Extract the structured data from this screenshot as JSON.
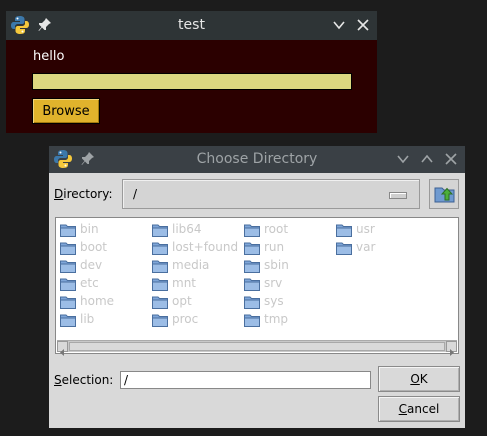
{
  "test_window": {
    "title": "test",
    "label": "hello",
    "entry_value": "",
    "browse_label": "Browse"
  },
  "dialog": {
    "title": "Choose Directory",
    "directory_label_u": "D",
    "directory_label_rest": "irectory:",
    "directory_value": "/",
    "selection_label_u": "S",
    "selection_label_rest": "election:",
    "selection_value": "/",
    "ok_label_u": "O",
    "ok_label_rest": "K",
    "cancel_label_u": "C",
    "cancel_label_rest": "ancel",
    "items": [
      {
        "name": "bin"
      },
      {
        "name": "boot"
      },
      {
        "name": "dev"
      },
      {
        "name": "etc"
      },
      {
        "name": "home"
      },
      {
        "name": "lib"
      },
      {
        "name": "lib64"
      },
      {
        "name": "lost+found"
      },
      {
        "name": "media"
      },
      {
        "name": "mnt"
      },
      {
        "name": "opt"
      },
      {
        "name": "proc"
      },
      {
        "name": "root"
      },
      {
        "name": "run"
      },
      {
        "name": "sbin"
      },
      {
        "name": "srv"
      },
      {
        "name": "sys"
      },
      {
        "name": "tmp"
      },
      {
        "name": "usr"
      },
      {
        "name": "var"
      }
    ]
  },
  "icons": {
    "app": "python-icon",
    "pin": "pin-icon",
    "minimize": "chevron-down-icon",
    "maximize": "chevron-up-icon",
    "close": "close-icon",
    "folder": "folder-icon",
    "up": "folder-up-icon"
  },
  "colors": {
    "test_bg": "#2b0000",
    "entry_bg": "#dcd780",
    "browse_bg": "#e0b32c"
  }
}
